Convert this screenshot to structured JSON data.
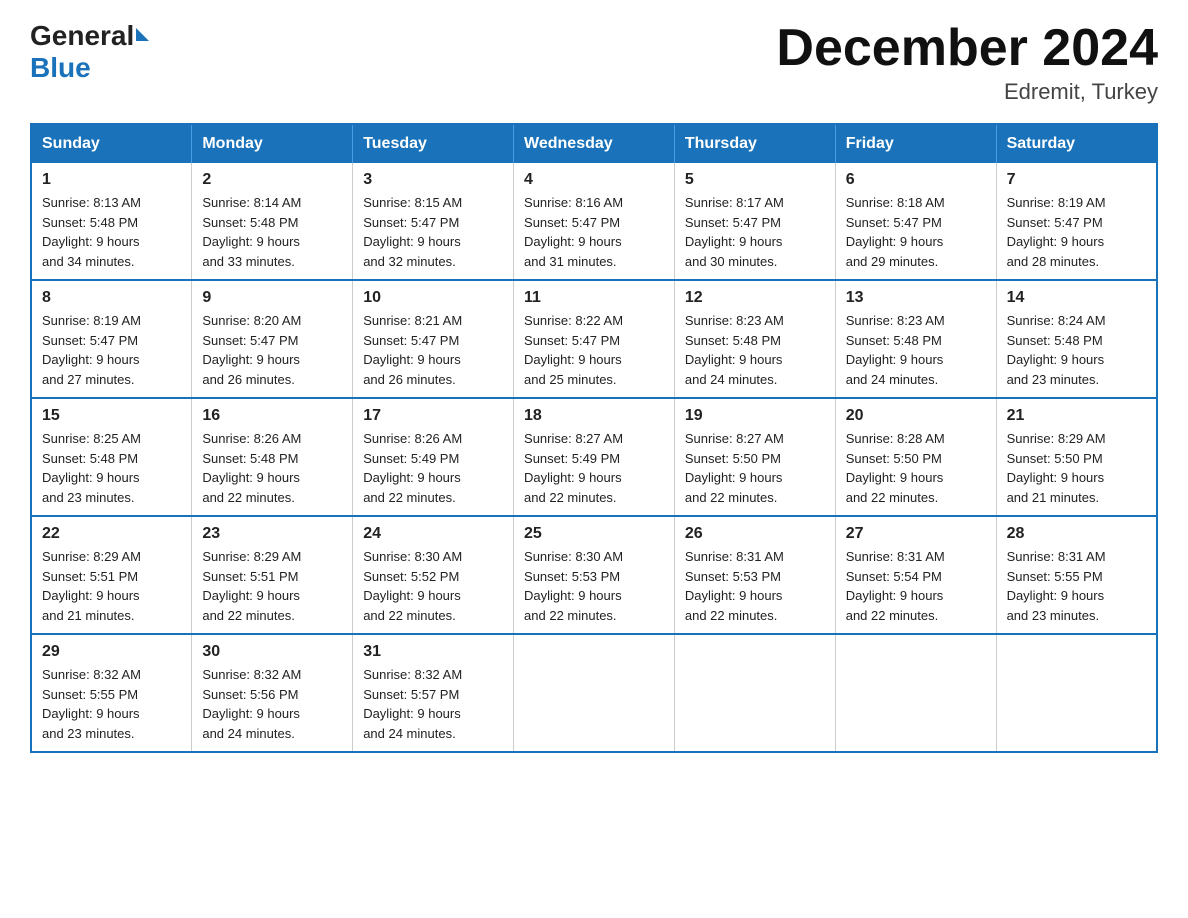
{
  "header": {
    "logo_general": "General",
    "logo_blue": "Blue",
    "month_year": "December 2024",
    "location": "Edremit, Turkey"
  },
  "days_of_week": [
    "Sunday",
    "Monday",
    "Tuesday",
    "Wednesday",
    "Thursday",
    "Friday",
    "Saturday"
  ],
  "weeks": [
    [
      {
        "num": "1",
        "sunrise": "8:13 AM",
        "sunset": "5:48 PM",
        "daylight": "9 hours and 34 minutes."
      },
      {
        "num": "2",
        "sunrise": "8:14 AM",
        "sunset": "5:48 PM",
        "daylight": "9 hours and 33 minutes."
      },
      {
        "num": "3",
        "sunrise": "8:15 AM",
        "sunset": "5:47 PM",
        "daylight": "9 hours and 32 minutes."
      },
      {
        "num": "4",
        "sunrise": "8:16 AM",
        "sunset": "5:47 PM",
        "daylight": "9 hours and 31 minutes."
      },
      {
        "num": "5",
        "sunrise": "8:17 AM",
        "sunset": "5:47 PM",
        "daylight": "9 hours and 30 minutes."
      },
      {
        "num": "6",
        "sunrise": "8:18 AM",
        "sunset": "5:47 PM",
        "daylight": "9 hours and 29 minutes."
      },
      {
        "num": "7",
        "sunrise": "8:19 AM",
        "sunset": "5:47 PM",
        "daylight": "9 hours and 28 minutes."
      }
    ],
    [
      {
        "num": "8",
        "sunrise": "8:19 AM",
        "sunset": "5:47 PM",
        "daylight": "9 hours and 27 minutes."
      },
      {
        "num": "9",
        "sunrise": "8:20 AM",
        "sunset": "5:47 PM",
        "daylight": "9 hours and 26 minutes."
      },
      {
        "num": "10",
        "sunrise": "8:21 AM",
        "sunset": "5:47 PM",
        "daylight": "9 hours and 26 minutes."
      },
      {
        "num": "11",
        "sunrise": "8:22 AM",
        "sunset": "5:47 PM",
        "daylight": "9 hours and 25 minutes."
      },
      {
        "num": "12",
        "sunrise": "8:23 AM",
        "sunset": "5:48 PM",
        "daylight": "9 hours and 24 minutes."
      },
      {
        "num": "13",
        "sunrise": "8:23 AM",
        "sunset": "5:48 PM",
        "daylight": "9 hours and 24 minutes."
      },
      {
        "num": "14",
        "sunrise": "8:24 AM",
        "sunset": "5:48 PM",
        "daylight": "9 hours and 23 minutes."
      }
    ],
    [
      {
        "num": "15",
        "sunrise": "8:25 AM",
        "sunset": "5:48 PM",
        "daylight": "9 hours and 23 minutes."
      },
      {
        "num": "16",
        "sunrise": "8:26 AM",
        "sunset": "5:48 PM",
        "daylight": "9 hours and 22 minutes."
      },
      {
        "num": "17",
        "sunrise": "8:26 AM",
        "sunset": "5:49 PM",
        "daylight": "9 hours and 22 minutes."
      },
      {
        "num": "18",
        "sunrise": "8:27 AM",
        "sunset": "5:49 PM",
        "daylight": "9 hours and 22 minutes."
      },
      {
        "num": "19",
        "sunrise": "8:27 AM",
        "sunset": "5:50 PM",
        "daylight": "9 hours and 22 minutes."
      },
      {
        "num": "20",
        "sunrise": "8:28 AM",
        "sunset": "5:50 PM",
        "daylight": "9 hours and 22 minutes."
      },
      {
        "num": "21",
        "sunrise": "8:29 AM",
        "sunset": "5:50 PM",
        "daylight": "9 hours and 21 minutes."
      }
    ],
    [
      {
        "num": "22",
        "sunrise": "8:29 AM",
        "sunset": "5:51 PM",
        "daylight": "9 hours and 21 minutes."
      },
      {
        "num": "23",
        "sunrise": "8:29 AM",
        "sunset": "5:51 PM",
        "daylight": "9 hours and 22 minutes."
      },
      {
        "num": "24",
        "sunrise": "8:30 AM",
        "sunset": "5:52 PM",
        "daylight": "9 hours and 22 minutes."
      },
      {
        "num": "25",
        "sunrise": "8:30 AM",
        "sunset": "5:53 PM",
        "daylight": "9 hours and 22 minutes."
      },
      {
        "num": "26",
        "sunrise": "8:31 AM",
        "sunset": "5:53 PM",
        "daylight": "9 hours and 22 minutes."
      },
      {
        "num": "27",
        "sunrise": "8:31 AM",
        "sunset": "5:54 PM",
        "daylight": "9 hours and 22 minutes."
      },
      {
        "num": "28",
        "sunrise": "8:31 AM",
        "sunset": "5:55 PM",
        "daylight": "9 hours and 23 minutes."
      }
    ],
    [
      {
        "num": "29",
        "sunrise": "8:32 AM",
        "sunset": "5:55 PM",
        "daylight": "9 hours and 23 minutes."
      },
      {
        "num": "30",
        "sunrise": "8:32 AM",
        "sunset": "5:56 PM",
        "daylight": "9 hours and 24 minutes."
      },
      {
        "num": "31",
        "sunrise": "8:32 AM",
        "sunset": "5:57 PM",
        "daylight": "9 hours and 24 minutes."
      },
      null,
      null,
      null,
      null
    ]
  ],
  "labels": {
    "sunrise": "Sunrise:",
    "sunset": "Sunset:",
    "daylight": "Daylight:"
  }
}
